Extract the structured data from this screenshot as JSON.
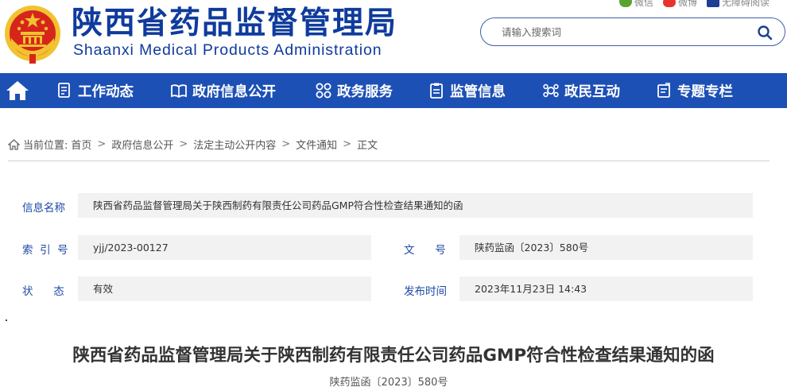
{
  "header": {
    "title": "陕西省药品监督管理局",
    "subtitle": "Shaanxi Medical Products Administration",
    "top_links": [
      {
        "label": "微信",
        "icon": "wechat-icon"
      },
      {
        "label": "微博",
        "icon": "weibo-icon"
      },
      {
        "label": "无障碍阅读",
        "icon": "accessibility-icon"
      }
    ],
    "search": {
      "placeholder": "请输入搜索词",
      "icon": "search-icon"
    }
  },
  "nav": {
    "home_icon": "home-icon",
    "items": [
      {
        "label": "工作动态",
        "icon": "document-list-icon"
      },
      {
        "label": "政府信息公开",
        "icon": "book-icon"
      },
      {
        "label": "政务服务",
        "icon": "grid-service-icon"
      },
      {
        "label": "监管信息",
        "icon": "clipboard-icon"
      },
      {
        "label": "政民互动",
        "icon": "interaction-icon"
      },
      {
        "label": "专题专栏",
        "icon": "topic-icon"
      }
    ]
  },
  "breadcrumb": {
    "prefix": "当前位置:",
    "items": [
      "首页",
      "政府信息公开",
      "法定主动公开内容",
      "文件通知",
      "正文"
    ]
  },
  "info": {
    "name_label": "信息名称",
    "name_value": "陕西省药品监督管理局关于陕西制药有限责任公司药品GMP符合性检查结果通知的函",
    "index_label": "索  引  号",
    "index_value": "yjj/2023-00127",
    "docno_label": "文      号",
    "docno_value": "陕药监函〔2023〕580号",
    "status_label": "状      态",
    "status_value": "有效",
    "date_label": "发布时间",
    "date_value": "2023年11月23日 14:43"
  },
  "article": {
    "title": "陕西省药品监督管理局关于陕西制药有限责任公司药品GMP符合性检查结果通知的函",
    "doc_number": "陕药监函〔2023〕580号"
  },
  "colors": {
    "brand_blue": "#0f3b9c",
    "nav_blue": "#1d50b5",
    "label_blue": "#1d4aa5",
    "value_bg": "#f2f2f2"
  }
}
